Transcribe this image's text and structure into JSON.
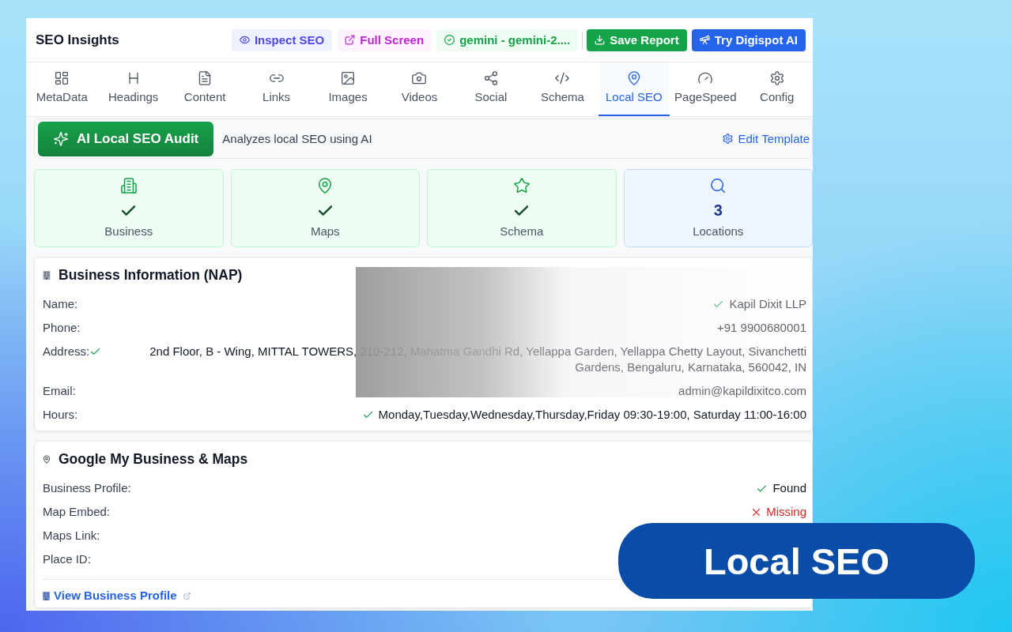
{
  "header": {
    "title": "SEO Insights",
    "actions": [
      {
        "kind": "inspect",
        "label": "Inspect SEO"
      },
      {
        "kind": "fullscreen",
        "label": "Full Screen"
      },
      {
        "kind": "model",
        "label": "gemini - gemini-2...."
      },
      {
        "kind": "save",
        "label": "Save Report"
      },
      {
        "kind": "try",
        "label": "Try Digispot AI"
      }
    ]
  },
  "tabs": [
    {
      "label": "MetaData",
      "selected": false
    },
    {
      "label": "Headings",
      "selected": false
    },
    {
      "label": "Content",
      "selected": false
    },
    {
      "label": "Links",
      "selected": false
    },
    {
      "label": "Images",
      "selected": false
    },
    {
      "label": "Videos",
      "selected": false
    },
    {
      "label": "Social",
      "selected": false
    },
    {
      "label": "Schema",
      "selected": false
    },
    {
      "label": "Local SEO",
      "selected": true
    },
    {
      "label": "PageSpeed",
      "selected": false
    },
    {
      "label": "Config",
      "selected": false
    }
  ],
  "audit": {
    "button": "AI Local SEO Audit",
    "description": "Analyzes local SEO using AI",
    "edit_link": "Edit Template"
  },
  "stats": [
    {
      "kind": "check",
      "label": "Business",
      "passed": true
    },
    {
      "kind": "check",
      "label": "Maps",
      "passed": true
    },
    {
      "kind": "check",
      "label": "Schema",
      "passed": true
    },
    {
      "kind": "count",
      "label": "Locations",
      "value": "3"
    }
  ],
  "business_info": {
    "title": "Business Information (NAP)",
    "rows": [
      {
        "label": "Name:",
        "value": "Kapil Dixit LLP",
        "verified": true
      },
      {
        "label": "Phone:",
        "value": "+91 9900680001",
        "verified": false
      },
      {
        "label": "Address:",
        "value": "2nd Floor, B - Wing, MITTAL TOWERS, 210-212, Mahatma Gandhi Rd, Yellappa Garden, Yellappa Chetty Layout, Sivanchetti Gardens, Bengaluru, Karnataka, 560042, IN",
        "verified": true
      },
      {
        "label": "Email:",
        "value": "admin@kapildixitco.com",
        "verified": false
      },
      {
        "label": "Hours:",
        "value": "Monday,Tuesday,Wednesday,Thursday,Friday 09:30-19:00, Saturday 11:00-16:00",
        "verified": true
      }
    ]
  },
  "google_business": {
    "title": "Google My Business & Maps",
    "rows": [
      {
        "label": "Business Profile:",
        "passed": true,
        "value": "Found"
      },
      {
        "label": "Map Embed:",
        "passed": false,
        "value": "Missing"
      },
      {
        "label": "Maps Link:"
      },
      {
        "label": "Place ID:"
      }
    ],
    "link": "View Business Profile"
  },
  "badge": {
    "text": "Local SEO"
  }
}
